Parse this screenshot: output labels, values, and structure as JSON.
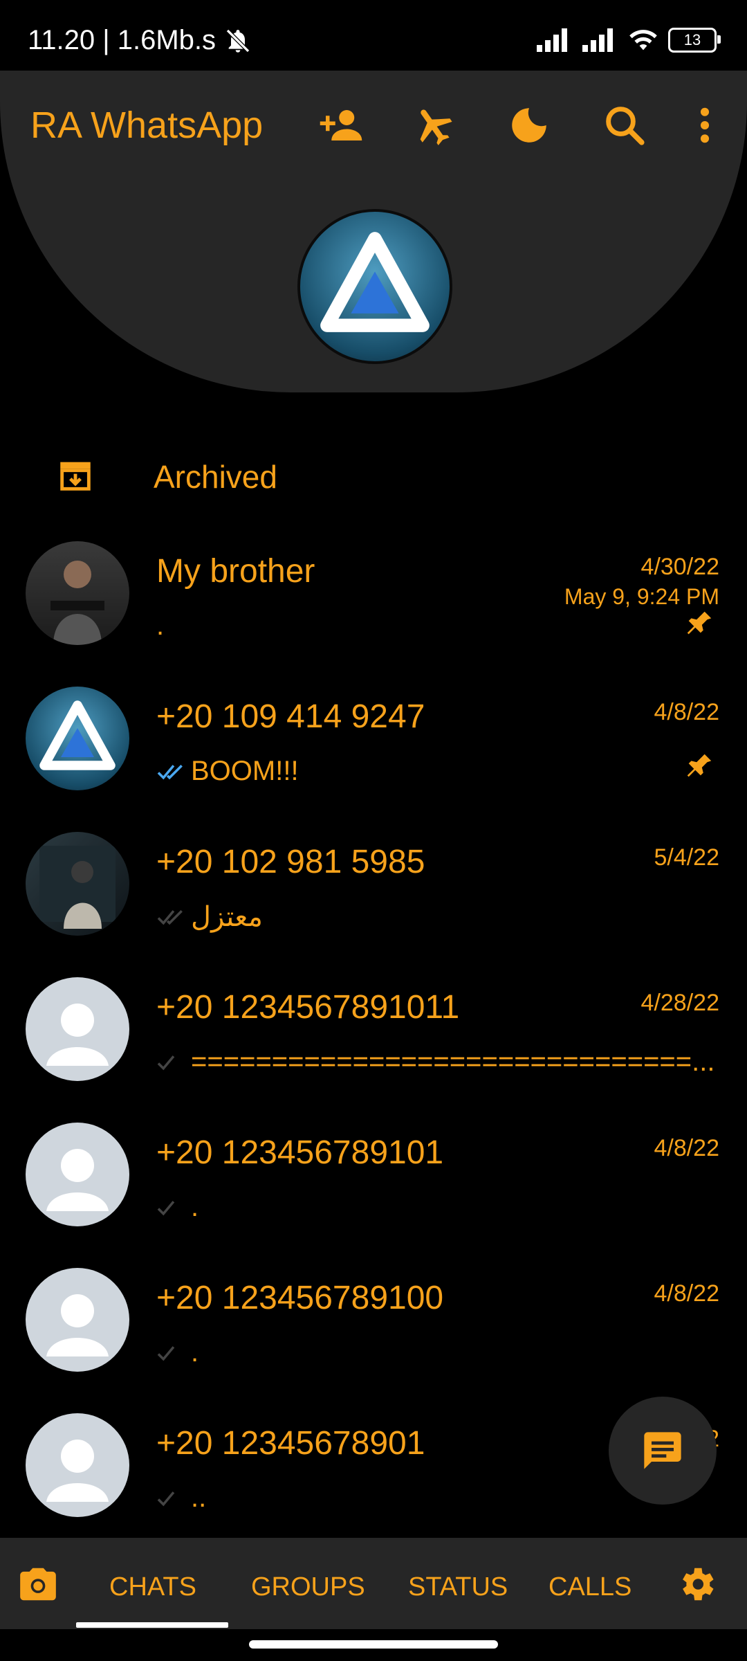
{
  "status_bar": {
    "time_speed": "11.20 | 1.6Mb.s",
    "battery": "13"
  },
  "header": {
    "title": "RA WhatsApp",
    "accent_color": "#f7a21b",
    "icons": [
      "add-contact-icon",
      "airplane-icon",
      "moon-icon",
      "search-icon",
      "more-icon"
    ]
  },
  "archived": {
    "label": "Archived"
  },
  "chats": [
    {
      "name": "My brother",
      "date": "4/30/22",
      "date2": "May 9, 9:24 PM",
      "preview": ".",
      "pinned": true,
      "tick": "none"
    },
    {
      "name": "+20 109 414 9247",
      "date": "4/8/22",
      "preview": "BOOM!!!",
      "pinned": true,
      "tick": "double-blue"
    },
    {
      "name": "+20 102 981 5985",
      "date": "5/4/22",
      "preview": "معتزل",
      "pinned": false,
      "tick": "double-grey"
    },
    {
      "name": "+20 1234567891011",
      "date": "4/28/22",
      "preview": "===============================...",
      "pinned": false,
      "tick": "single-grey"
    },
    {
      "name": "+20 123456789101",
      "date": "4/8/22",
      "preview": ".",
      "pinned": false,
      "tick": "single-grey"
    },
    {
      "name": "+20 123456789100",
      "date": "4/8/22",
      "preview": ".",
      "pinned": false,
      "tick": "single-grey"
    },
    {
      "name": "+20 12345678901",
      "date": "2",
      "preview": "..",
      "pinned": false,
      "tick": "single-grey"
    }
  ],
  "bottom_nav": {
    "chats": "CHATS",
    "groups": "GROUPS",
    "status": "STATUS",
    "calls": "CALLS"
  }
}
